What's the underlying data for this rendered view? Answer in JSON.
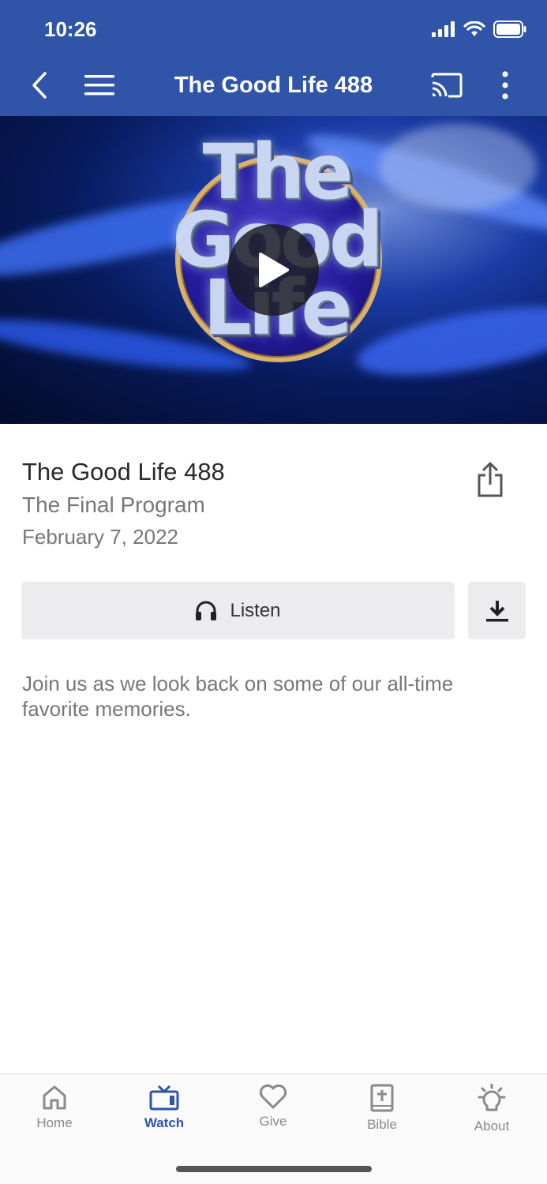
{
  "status_bar": {
    "time": "10:26"
  },
  "header": {
    "title": "The Good Life 488",
    "back_icon": "chevron-left-icon",
    "menu_icon": "hamburger-menu-icon",
    "cast_icon": "cast-icon",
    "more_icon": "more-vertical-icon",
    "background_color": "#2f54a8"
  },
  "hero": {
    "logo_text": "The Good Life",
    "play_icon": "play-icon"
  },
  "episode": {
    "title": "The Good Life 488",
    "subtitle": "The Final Program",
    "date": "February 7, 2022",
    "share_icon": "share-icon"
  },
  "actions": {
    "listen_label": "Listen",
    "listen_icon": "headphones-icon",
    "download_icon": "download-icon"
  },
  "description": "Join us as we look back on some of our all-time favorite memories.",
  "tabbar": {
    "active": "Watch",
    "accent_color": "#2f54a8",
    "items": [
      {
        "label": "Home",
        "icon": "home-icon"
      },
      {
        "label": "Watch",
        "icon": "tv-icon"
      },
      {
        "label": "Give",
        "icon": "heart-icon"
      },
      {
        "label": "Bible",
        "icon": "bible-icon"
      },
      {
        "label": "About",
        "icon": "lightbulb-icon"
      }
    ]
  }
}
